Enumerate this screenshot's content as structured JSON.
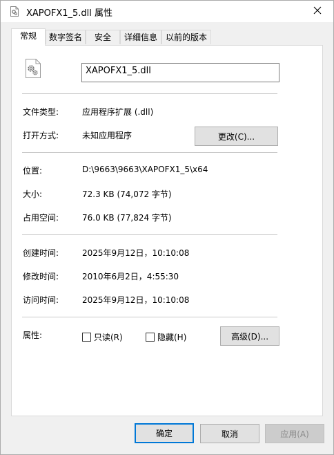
{
  "window": {
    "title": "XAPOFX1_5.dll 属性",
    "close_label": "✕"
  },
  "tabs": [
    {
      "label": "常规",
      "active": true
    },
    {
      "label": "数字签名",
      "active": false
    },
    {
      "label": "安全",
      "active": false
    },
    {
      "label": "详细信息",
      "active": false
    },
    {
      "label": "以前的版本",
      "active": false
    }
  ],
  "general": {
    "file_name": "XAPOFX1_5.dll",
    "file_type_label": "文件类型:",
    "file_type_value": "应用程序扩展 (.dll)",
    "open_with_label": "打开方式:",
    "open_with_value": "未知应用程序",
    "change_button": "更改(C)...",
    "location_label": "位置:",
    "location_value": "D:\\9663\\9663\\XAPOFX1_5\\x64",
    "size_label": "大小:",
    "size_value": "72.3 KB (74,072 字节)",
    "size_on_disk_label": "占用空间:",
    "size_on_disk_value": "76.0 KB (77,824 字节)",
    "created_label": "创建时间:",
    "created_value": "2025年9月12日，10:10:08",
    "modified_label": "修改时间:",
    "modified_value": "2010年6月2日，4:55:30",
    "accessed_label": "访问时间:",
    "accessed_value": "2025年9月12日，10:10:08",
    "attributes_label": "属性:",
    "readonly_label": "只读(R)",
    "readonly_checked": false,
    "hidden_label": "隐藏(H)",
    "hidden_checked": false,
    "advanced_button": "高级(D)..."
  },
  "footer": {
    "ok_button": "确定",
    "cancel_button": "取消",
    "apply_button": "应用(A)"
  },
  "icons": {
    "title_icon": "file-gear-icon",
    "file_icon": "dll-gear-icon",
    "close_icon": "close-icon"
  },
  "colors": {
    "primary_button_border": "#0078d7"
  }
}
